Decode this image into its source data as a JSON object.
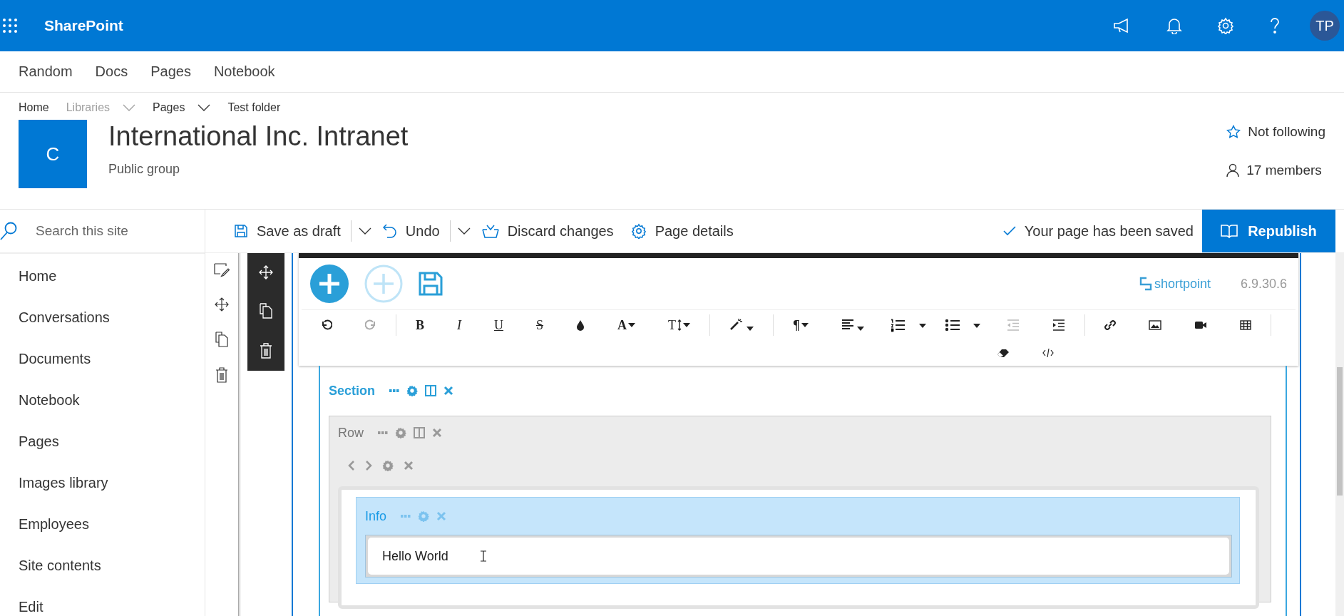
{
  "app_bar": {
    "brand": "SharePoint",
    "avatar": "TP"
  },
  "hub_nav": [
    {
      "label": "Random"
    },
    {
      "label": "Docs"
    },
    {
      "label": "Pages"
    },
    {
      "label": "Notebook"
    }
  ],
  "breadcrumb": [
    {
      "label": "Home",
      "disabled": false,
      "dropdown": false
    },
    {
      "label": "Libraries",
      "disabled": true,
      "dropdown": true
    },
    {
      "label": "Pages",
      "disabled": false,
      "dropdown": true
    },
    {
      "label": "Test folder",
      "disabled": false,
      "dropdown": false
    }
  ],
  "site": {
    "logo_letter": "C",
    "title": "International Inc. Intranet",
    "subtitle": "Public group",
    "follow": "Not following",
    "members": "17 members"
  },
  "search": {
    "placeholder": "Search this site"
  },
  "sidebar": {
    "items": [
      {
        "label": "Home"
      },
      {
        "label": "Conversations"
      },
      {
        "label": "Documents"
      },
      {
        "label": "Notebook"
      },
      {
        "label": "Pages"
      },
      {
        "label": "Images library"
      },
      {
        "label": "Employees"
      },
      {
        "label": "Site contents"
      },
      {
        "label": "Edit"
      }
    ]
  },
  "command_bar": {
    "save": "Save as draft",
    "undo": "Undo",
    "discard": "Discard changes",
    "details": "Page details",
    "status": "Your page has been saved",
    "publish": "Republish"
  },
  "editor": {
    "brand": "shortpoint",
    "version": "6.9.30.6",
    "format": {
      "bold": "B",
      "italic": "I",
      "underline": "U",
      "strike": "S",
      "font_color": "A",
      "font_size": "T",
      "paragraph": "¶"
    }
  },
  "section": {
    "label": "Section"
  },
  "row": {
    "label": "Row"
  },
  "info": {
    "label": "Info",
    "text": "Hello World"
  }
}
